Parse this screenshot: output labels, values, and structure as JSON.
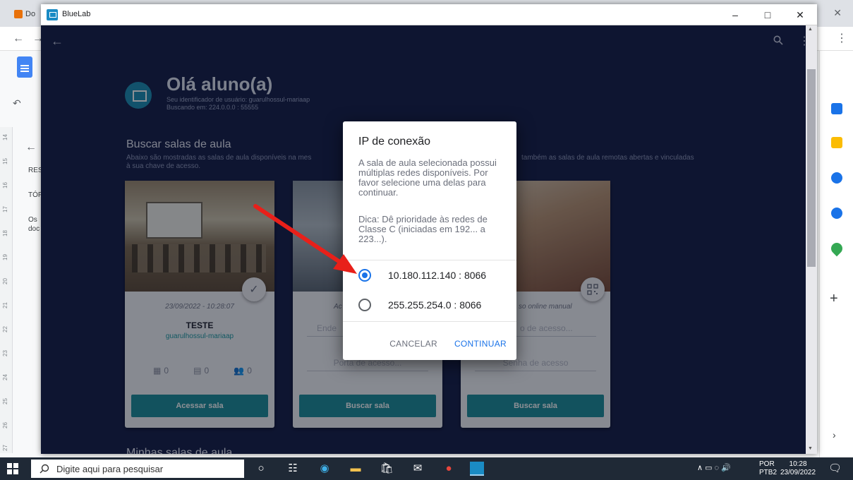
{
  "background_browser": {
    "tab_label": "Do",
    "sidebar_labels": [
      "RES",
      "TÓP",
      "Os",
      "doc"
    ],
    "ruler_marks": [
      "14",
      "15",
      "16",
      "17",
      "18",
      "19",
      "20",
      "21",
      "22",
      "23",
      "24",
      "25",
      "26",
      "27"
    ]
  },
  "window": {
    "title": "BlueLab",
    "minimize": "–",
    "maximize": "□",
    "close": "✕"
  },
  "app": {
    "greeting": "Olá aluno(a)",
    "user_id_line": "Seu identificador de usuário: guarulhossul-mariaap",
    "searching_line": "Buscando em: 224.0.0.0 : 55555",
    "section_title": "Buscar salas de aula",
    "section_desc_left": "Abaixo são mostradas as salas de aula disponíveis na mes",
    "section_desc_right": "também as salas de aula remotas abertas e vinculadas",
    "section_desc_line2": "à sua chave de acesso.",
    "next_section_title": "Minhas salas de aula"
  },
  "cards": [
    {
      "date": "23/09/2022 - 10:28:07",
      "name": "TESTE",
      "user": "guarulhossul-mariaap",
      "stats": [
        "0",
        "0",
        "0"
      ],
      "button": "Acessar sala"
    },
    {
      "subtitle": "Ac",
      "field1": "Ende",
      "field2": "Porta de acesso...",
      "button": "Buscar sala"
    },
    {
      "subtitle": "so online manual",
      "field1": "o de acesso...",
      "field2": "Senha de acesso",
      "button": "Buscar sala"
    }
  ],
  "dialog": {
    "title": "IP de conexão",
    "text": "A sala de aula selecionada possui múltiplas redes disponíveis. Por favor selecione uma delas para continuar.",
    "hint": "Dica: Dê prioridade às redes de Classe C (iniciadas em 192... a 223...).",
    "options": [
      {
        "label": "10.180.112.140 : 8066",
        "selected": true
      },
      {
        "label": "255.255.254.0 : 8066",
        "selected": false
      }
    ],
    "cancel": "CANCELAR",
    "continue": "CONTINUAR"
  },
  "taskbar": {
    "search_placeholder": "Digite aqui para pesquisar",
    "lang_top": "POR",
    "lang_bottom": "PTB2",
    "time": "10:28",
    "date": "23/09/2022"
  },
  "colors": {
    "app_bg": "#17204a",
    "accent": "#1e8f9c",
    "dialog_primary": "#1a73e8",
    "arrow": "#e8201a"
  }
}
